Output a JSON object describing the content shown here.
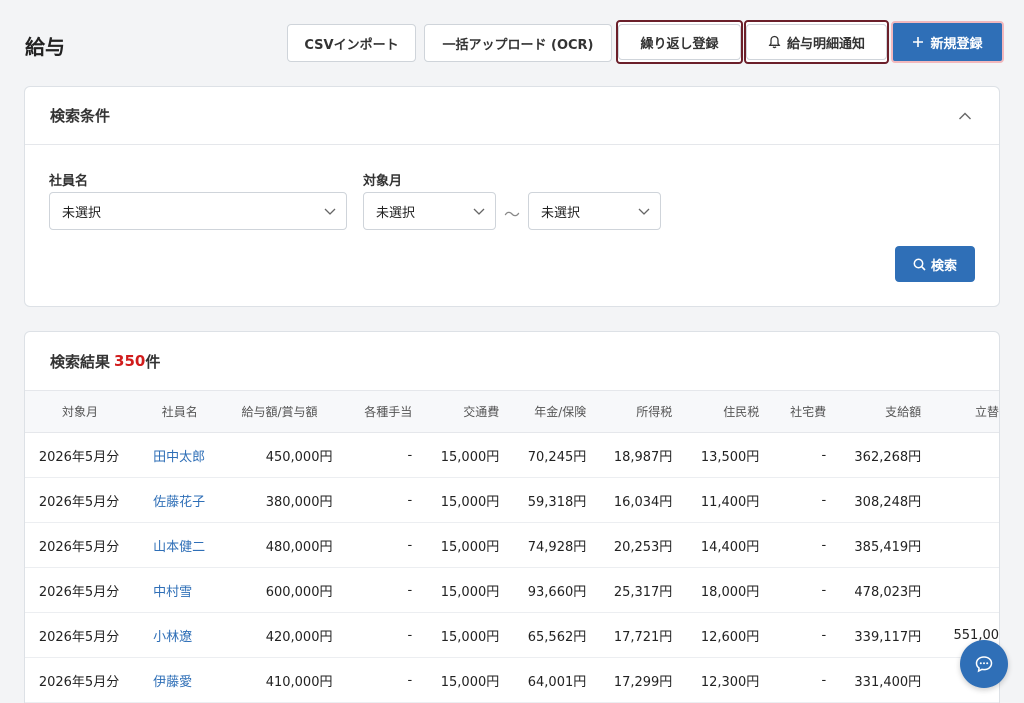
{
  "header": {
    "title": "給与",
    "csv_import": "CSVインポート",
    "bulk_upload": "一括アップロード (OCR)",
    "recurring": "繰り返し登録",
    "notify": "給与明細通知",
    "new_entry": "新規登録"
  },
  "search": {
    "title": "検索条件",
    "employee_label": "社員名",
    "employee_value": "未選択",
    "month_label": "対象月",
    "month_from": "未選択",
    "tilde": "〜",
    "month_to": "未選択",
    "search_button": "検索"
  },
  "results": {
    "title": "検索結果",
    "count": "350",
    "count_suffix": "件",
    "columns": [
      "対象月",
      "社員名",
      "給与額/賞与額",
      "各種手当",
      "交通費",
      "年金/保険",
      "所得税",
      "住民税",
      "社宅費",
      "支給額",
      "立替"
    ],
    "rows": [
      {
        "month": "2026年5月分",
        "name": "田中太郎",
        "salary": "450,000円",
        "allowance": "-",
        "transport": "15,000円",
        "pension": "70,245円",
        "income_tax": "18,987円",
        "resident_tax": "13,500円",
        "housing": "-",
        "payment": "362,268円",
        "advance": ""
      },
      {
        "month": "2026年5月分",
        "name": "佐藤花子",
        "salary": "380,000円",
        "allowance": "-",
        "transport": "15,000円",
        "pension": "59,318円",
        "income_tax": "16,034円",
        "resident_tax": "11,400円",
        "housing": "-",
        "payment": "308,248円",
        "advance": ""
      },
      {
        "month": "2026年5月分",
        "name": "山本健二",
        "salary": "480,000円",
        "allowance": "-",
        "transport": "15,000円",
        "pension": "74,928円",
        "income_tax": "20,253円",
        "resident_tax": "14,400円",
        "housing": "-",
        "payment": "385,419円",
        "advance": ""
      },
      {
        "month": "2026年5月分",
        "name": "中村雪",
        "salary": "600,000円",
        "allowance": "-",
        "transport": "15,000円",
        "pension": "93,660円",
        "income_tax": "25,317円",
        "resident_tax": "18,000円",
        "housing": "-",
        "payment": "478,023円",
        "advance": ""
      },
      {
        "month": "2026年5月分",
        "name": "小林遼",
        "salary": "420,000円",
        "allowance": "-",
        "transport": "15,000円",
        "pension": "65,562円",
        "income_tax": "17,721円",
        "resident_tax": "12,600円",
        "housing": "-",
        "payment": "339,117円",
        "advance": "551,00"
      },
      {
        "month": "2026年5月分",
        "name": "伊藤愛",
        "salary": "410,000円",
        "allowance": "-",
        "transport": "15,000円",
        "pension": "64,001円",
        "income_tax": "17,299円",
        "resident_tax": "12,300円",
        "housing": "-",
        "payment": "331,400円",
        "advance": ""
      }
    ]
  },
  "icons": {
    "collapse": "chevron-up-icon",
    "dropdown": "chevron-down-icon",
    "search": "search-icon",
    "bell": "bell-icon",
    "plus": "plus-icon",
    "chat": "chat-icon"
  },
  "colors": {
    "primary": "#2f6fb7",
    "count": "#d11c1c",
    "focus_outline": "#6b1f2a"
  }
}
